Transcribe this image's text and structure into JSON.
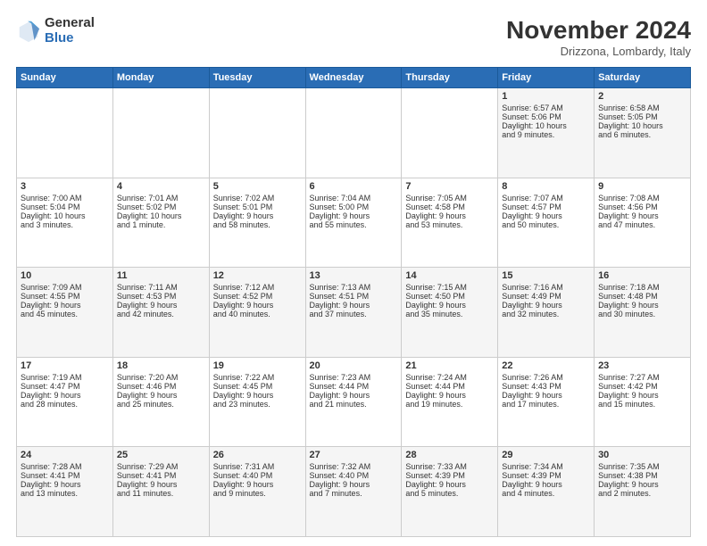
{
  "logo": {
    "general": "General",
    "blue": "Blue"
  },
  "title": "November 2024",
  "location": "Drizzona, Lombardy, Italy",
  "weekdays": [
    "Sunday",
    "Monday",
    "Tuesday",
    "Wednesday",
    "Thursday",
    "Friday",
    "Saturday"
  ],
  "weeks": [
    [
      {
        "day": "",
        "info": ""
      },
      {
        "day": "",
        "info": ""
      },
      {
        "day": "",
        "info": ""
      },
      {
        "day": "",
        "info": ""
      },
      {
        "day": "",
        "info": ""
      },
      {
        "day": "1",
        "info": "Sunrise: 6:57 AM\nSunset: 5:06 PM\nDaylight: 10 hours\nand 9 minutes."
      },
      {
        "day": "2",
        "info": "Sunrise: 6:58 AM\nSunset: 5:05 PM\nDaylight: 10 hours\nand 6 minutes."
      }
    ],
    [
      {
        "day": "3",
        "info": "Sunrise: 7:00 AM\nSunset: 5:04 PM\nDaylight: 10 hours\nand 3 minutes."
      },
      {
        "day": "4",
        "info": "Sunrise: 7:01 AM\nSunset: 5:02 PM\nDaylight: 10 hours\nand 1 minute."
      },
      {
        "day": "5",
        "info": "Sunrise: 7:02 AM\nSunset: 5:01 PM\nDaylight: 9 hours\nand 58 minutes."
      },
      {
        "day": "6",
        "info": "Sunrise: 7:04 AM\nSunset: 5:00 PM\nDaylight: 9 hours\nand 55 minutes."
      },
      {
        "day": "7",
        "info": "Sunrise: 7:05 AM\nSunset: 4:58 PM\nDaylight: 9 hours\nand 53 minutes."
      },
      {
        "day": "8",
        "info": "Sunrise: 7:07 AM\nSunset: 4:57 PM\nDaylight: 9 hours\nand 50 minutes."
      },
      {
        "day": "9",
        "info": "Sunrise: 7:08 AM\nSunset: 4:56 PM\nDaylight: 9 hours\nand 47 minutes."
      }
    ],
    [
      {
        "day": "10",
        "info": "Sunrise: 7:09 AM\nSunset: 4:55 PM\nDaylight: 9 hours\nand 45 minutes."
      },
      {
        "day": "11",
        "info": "Sunrise: 7:11 AM\nSunset: 4:53 PM\nDaylight: 9 hours\nand 42 minutes."
      },
      {
        "day": "12",
        "info": "Sunrise: 7:12 AM\nSunset: 4:52 PM\nDaylight: 9 hours\nand 40 minutes."
      },
      {
        "day": "13",
        "info": "Sunrise: 7:13 AM\nSunset: 4:51 PM\nDaylight: 9 hours\nand 37 minutes."
      },
      {
        "day": "14",
        "info": "Sunrise: 7:15 AM\nSunset: 4:50 PM\nDaylight: 9 hours\nand 35 minutes."
      },
      {
        "day": "15",
        "info": "Sunrise: 7:16 AM\nSunset: 4:49 PM\nDaylight: 9 hours\nand 32 minutes."
      },
      {
        "day": "16",
        "info": "Sunrise: 7:18 AM\nSunset: 4:48 PM\nDaylight: 9 hours\nand 30 minutes."
      }
    ],
    [
      {
        "day": "17",
        "info": "Sunrise: 7:19 AM\nSunset: 4:47 PM\nDaylight: 9 hours\nand 28 minutes."
      },
      {
        "day": "18",
        "info": "Sunrise: 7:20 AM\nSunset: 4:46 PM\nDaylight: 9 hours\nand 25 minutes."
      },
      {
        "day": "19",
        "info": "Sunrise: 7:22 AM\nSunset: 4:45 PM\nDaylight: 9 hours\nand 23 minutes."
      },
      {
        "day": "20",
        "info": "Sunrise: 7:23 AM\nSunset: 4:44 PM\nDaylight: 9 hours\nand 21 minutes."
      },
      {
        "day": "21",
        "info": "Sunrise: 7:24 AM\nSunset: 4:44 PM\nDaylight: 9 hours\nand 19 minutes."
      },
      {
        "day": "22",
        "info": "Sunrise: 7:26 AM\nSunset: 4:43 PM\nDaylight: 9 hours\nand 17 minutes."
      },
      {
        "day": "23",
        "info": "Sunrise: 7:27 AM\nSunset: 4:42 PM\nDaylight: 9 hours\nand 15 minutes."
      }
    ],
    [
      {
        "day": "24",
        "info": "Sunrise: 7:28 AM\nSunset: 4:41 PM\nDaylight: 9 hours\nand 13 minutes."
      },
      {
        "day": "25",
        "info": "Sunrise: 7:29 AM\nSunset: 4:41 PM\nDaylight: 9 hours\nand 11 minutes."
      },
      {
        "day": "26",
        "info": "Sunrise: 7:31 AM\nSunset: 4:40 PM\nDaylight: 9 hours\nand 9 minutes."
      },
      {
        "day": "27",
        "info": "Sunrise: 7:32 AM\nSunset: 4:40 PM\nDaylight: 9 hours\nand 7 minutes."
      },
      {
        "day": "28",
        "info": "Sunrise: 7:33 AM\nSunset: 4:39 PM\nDaylight: 9 hours\nand 5 minutes."
      },
      {
        "day": "29",
        "info": "Sunrise: 7:34 AM\nSunset: 4:39 PM\nDaylight: 9 hours\nand 4 minutes."
      },
      {
        "day": "30",
        "info": "Sunrise: 7:35 AM\nSunset: 4:38 PM\nDaylight: 9 hours\nand 2 minutes."
      }
    ]
  ]
}
